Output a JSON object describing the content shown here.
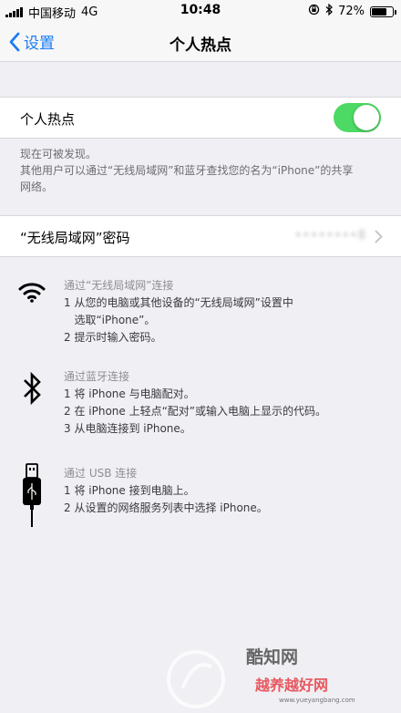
{
  "status_bar": {
    "carrier": "中国移动",
    "network": "4G",
    "time": "10:48",
    "battery": "72%",
    "battery_level": 0.72
  },
  "nav": {
    "back_label": "设置",
    "title": "个人热点"
  },
  "hotspot": {
    "label": "个人热点",
    "enabled": true
  },
  "discover_note": {
    "line1": "现在可被发现。",
    "line2": "其他用户可以通过“无线局域网”和蓝牙查找您的名为“iPhone”的共享",
    "line3": "网络。"
  },
  "password": {
    "label": "“无线局域网”密码",
    "value": "••••••••8"
  },
  "wifi_instructions": {
    "heading": "通过“无线局域网”连接",
    "steps": [
      "1 从您的电脑或其他设备的“无线局域网”设置中",
      "   选取“iPhone”。",
      "2 提示时输入密码。"
    ]
  },
  "bluetooth_instructions": {
    "heading": "通过蓝牙连接",
    "steps": [
      "1 将 iPhone 与电脑配对。",
      "2 在 iPhone 上轻点“配对”或输入电脑上显示的代码。",
      "3 从电脑连接到 iPhone。"
    ]
  },
  "usb_instructions": {
    "heading": "通过 USB 连接",
    "steps": [
      "1 将 iPhone 接到电脑上。",
      "2 从设置的网络服务列表中选择 iPhone。"
    ]
  },
  "watermark": {
    "brand1": "酷知网",
    "brand2": "越养越好网",
    "url": "www.yueyangbang.com"
  },
  "colors": {
    "accent": "#1a7cf5",
    "toggle_on": "#4cd964",
    "background": "#efeff4"
  }
}
